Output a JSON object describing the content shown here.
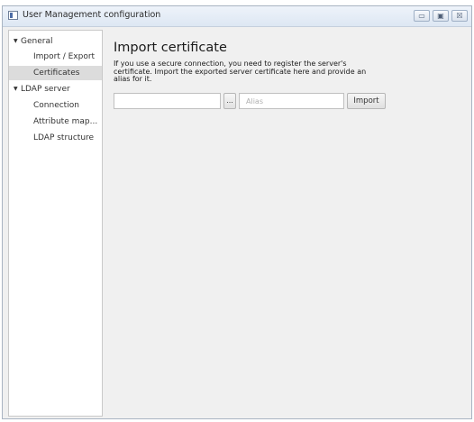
{
  "window": {
    "title": "User Management configuration",
    "controls": {
      "minimize": "▭",
      "maximize": "▣",
      "close": "☒"
    }
  },
  "sidebar": {
    "items": [
      {
        "label": "General",
        "level": 0,
        "expanded": true
      },
      {
        "label": "Import / Export",
        "level": 1
      },
      {
        "label": "Certificates",
        "level": 1,
        "selected": true
      },
      {
        "label": "LDAP server",
        "level": 0,
        "expanded": true
      },
      {
        "label": "Connection",
        "level": 1
      },
      {
        "label": "Attribute map...",
        "level": 1
      },
      {
        "label": "LDAP structure",
        "level": 1
      }
    ],
    "expand_arrow": "▼"
  },
  "main": {
    "heading": "Import certificate",
    "description": "If you use a secure connection, you need to register the server's certificate. Import the exported server certificate here and provide an alias for it.",
    "file_field": {
      "value": ""
    },
    "browse_label": "...",
    "alias_field": {
      "value": "",
      "placeholder": "Alias"
    },
    "import_label": "Import"
  }
}
